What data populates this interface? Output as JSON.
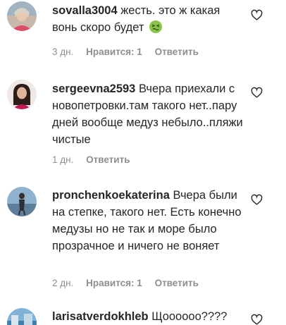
{
  "comments": [
    {
      "username": "sovalla3004",
      "text": "жесть. это ж какая вонь скоро будет",
      "emoji": "nauseated-face",
      "time": "3 дн.",
      "likes": "Нравится: 1",
      "reply": "Ответить"
    },
    {
      "username": "sergeevna2593",
      "text": "Вчера приехали с новопетровки.там такого нет..пару дней вообще медуз небыло..пляжи чистые",
      "time": "1 дн.",
      "reply": "Ответить"
    },
    {
      "username": "pronchenkoekaterina",
      "text": "Вчера были на степке, такого нет. Есть конечно медузы но не так и море было прозрачное и ничего не воняет",
      "time": "2 дн.",
      "likes": "Нравится: 1",
      "reply": "Ответить"
    },
    {
      "username": "larisatverdokhleb",
      "text": "Щоооооо????"
    }
  ],
  "colors": {
    "text": "#262626",
    "secondary": "#8e8e8e"
  }
}
